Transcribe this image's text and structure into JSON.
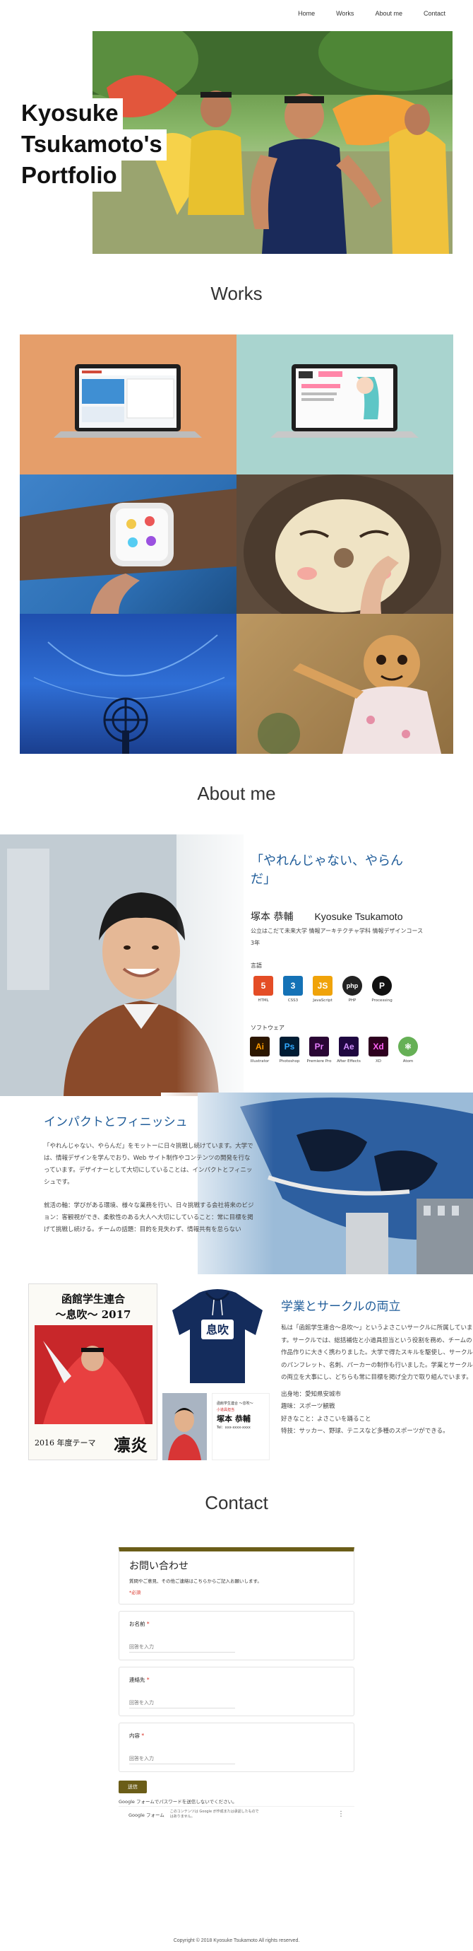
{
  "nav": {
    "items": [
      "Home",
      "Works",
      "About me",
      "Contact"
    ]
  },
  "hero": {
    "title_lines": [
      "Kyosuke",
      "Tsukamoto's",
      "Portfolio"
    ]
  },
  "works": {
    "title": "Works"
  },
  "about": {
    "title": "About me",
    "quote": "「やれんじゃない、やらんだ」",
    "name_jp": "塚本 恭輔",
    "name_en": "Kyosuke Tsukamoto",
    "affiliation": "公立はこだて未来大学 情報アーキテクチャ学科 情報デザインコース 3年",
    "languages_label": "言語",
    "software_label": "ソフトウェア",
    "languages": [
      {
        "name": "HTML",
        "icon": "5",
        "color": "#e44d26"
      },
      {
        "name": "CSS3",
        "icon": "3",
        "color": "#1572b6"
      },
      {
        "name": "JavaScript",
        "icon": "JS",
        "color": "#f0a30a"
      },
      {
        "name": "PHP",
        "icon": "php",
        "color": "#222222"
      },
      {
        "name": "Processing",
        "icon": "P",
        "color": "#111111"
      }
    ],
    "software": [
      {
        "name": "Illustrator",
        "icon": "Ai",
        "color": "#2c1600"
      },
      {
        "name": "Photoshop",
        "icon": "Ps",
        "color": "#001c34"
      },
      {
        "name": "Premiere Pro",
        "icon": "Pr",
        "color": "#2a0634"
      },
      {
        "name": "After Effects",
        "icon": "Ae",
        "color": "#1f0740"
      },
      {
        "name": "XD",
        "icon": "Xd",
        "color": "#2e001f"
      },
      {
        "name": "Atom",
        "icon": "⚛",
        "color": "#66b056"
      }
    ]
  },
  "impact": {
    "title": "インパクトとフィニッシュ",
    "paragraphs": [
      "「やれんじゃない、やらんだ」をモットーに日々挑戦し続けています。大学では、情報デザインを学んでおり、Web サイト制作やコンテンツの開発を行なっています。デザイナーとして大切にしていることは、インパクトとフィニッシュです。",
      "就活の軸：学びがある環境、様々な業務を行い、日々挑戦する会社将来のビジョン：客観視ができ、柔軟性のある大人へ大切にしていること：常に目標を掲げて挑戦し続ける。チームの話題：目的を見失わず、情報共有を怠らない"
    ]
  },
  "circle": {
    "title": "学業とサークルの両立",
    "paragraphs": [
      "私は「函館学生連合〜息吹〜」というよさこいサークルに所属しています。サークルでは、総括補佐と小道具担当という役割を務め、チームの作品作りに大きく携わりました。大学で得たスキルを駆使し、サークルのパンフレット、名刺、パーカーの制作も行いました。学業とサークルの両立を大事にし、どちらも常に目標を掲げ全力で取り組んでいます。",
      "出身地：愛知県安城市",
      "趣味：スポーツ観戦",
      "好きなこと：よさこいを踊ること",
      "特技：サッカー、野球、テニスなど多種のスポーツができる。"
    ],
    "poster": {
      "line1": "函館学生連合",
      "line2": "〜息吹〜 2017",
      "line3": "2016 年度テーマ",
      "line4": "凛炎"
    },
    "card": {
      "org": "函館学生連合 〜息吹〜",
      "role": "小道具担当",
      "name": "塚本 恭輔",
      "detail": "Tel：xxx-xxxx-xxxx"
    },
    "hoodie_text": "息吹"
  },
  "contact": {
    "title": "Contact",
    "form_title": "お問い合わせ",
    "form_desc": "質問やご意見、その他ご連絡はこちらからご記入お願いします。",
    "required_note": "*必須",
    "fields": [
      {
        "label": "お名前",
        "placeholder": "回答を入力"
      },
      {
        "label": "連絡先",
        "placeholder": "回答を入力"
      },
      {
        "label": "内容",
        "placeholder": "回答を入力"
      }
    ],
    "submit": "送信",
    "note": "Google フォームでパスワードを送信しないでください。",
    "footer_brand": "Google フォーム",
    "footer_legal": "このコンテンツは Google が作成または承認したものではありません。"
  },
  "footer": {
    "copyright": "Copyright © 2018 Kyosuke Tsukamoto All rights reserved."
  }
}
